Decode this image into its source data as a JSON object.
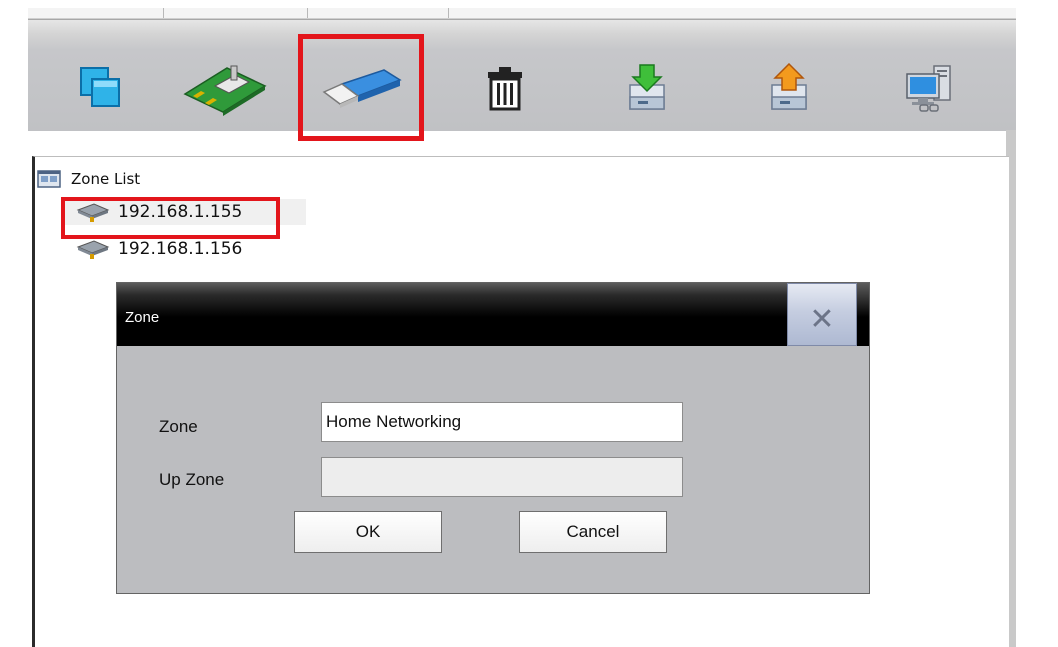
{
  "toolbar": {
    "buttons": [
      {
        "name": "copy-zone-icon"
      },
      {
        "name": "network-card-icon"
      },
      {
        "name": "usb-drive-icon"
      },
      {
        "name": "trash-icon"
      },
      {
        "name": "import-icon"
      },
      {
        "name": "export-icon"
      },
      {
        "name": "network-computer-icon"
      }
    ]
  },
  "tree": {
    "root_label": "Zone List",
    "items": [
      {
        "label": "192.168.1.155"
      },
      {
        "label": "192.168.1.156"
      }
    ]
  },
  "dialog": {
    "title": "Zone",
    "close_glyph": "✕",
    "zone_label": "Zone",
    "zone_value": "Home Networking",
    "up_zone_label": "Up Zone",
    "up_zone_value": "",
    "ok_label": "OK",
    "cancel_label": "Cancel"
  },
  "colors": {
    "highlight_outline": "#e3151b",
    "toolbar_bg": "#c4c5c8",
    "dialog_body": "#bcbdc0"
  }
}
